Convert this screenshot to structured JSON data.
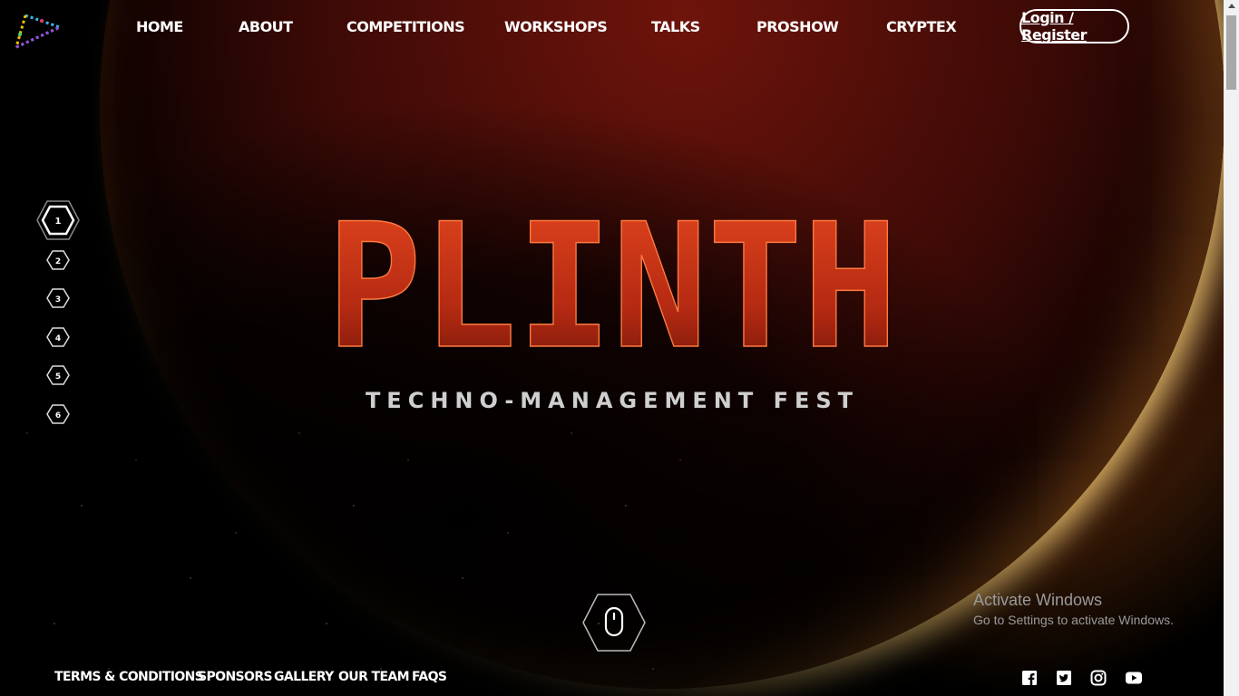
{
  "nav": {
    "items": [
      "HOME",
      "ABOUT",
      "COMPETITIONS",
      "WORKSHOPS",
      "TALKS",
      "PROSHOW",
      "CRYPTEX"
    ],
    "login_label": "Login / Register"
  },
  "hero": {
    "title": "PLINTH",
    "tagline": "TECHNO-MANAGEMENT FEST"
  },
  "pager": {
    "items": [
      "1",
      "2",
      "3",
      "4",
      "5",
      "6"
    ],
    "active_index": 0
  },
  "footer": {
    "links": [
      "TERMS & CONDITIONS",
      "SPONSORS",
      "GALLERY",
      "OUR TEAM",
      "FAQS"
    ],
    "social_icons": [
      "facebook-icon",
      "twitter-icon",
      "instagram-icon",
      "youtube-icon"
    ]
  },
  "watermark": {
    "title": "Activate Windows",
    "subtitle": "Go to Settings to activate Windows."
  },
  "colors": {
    "title_red": "#d0361b",
    "accent_gold": "#ffb14a",
    "background": "#000000"
  }
}
